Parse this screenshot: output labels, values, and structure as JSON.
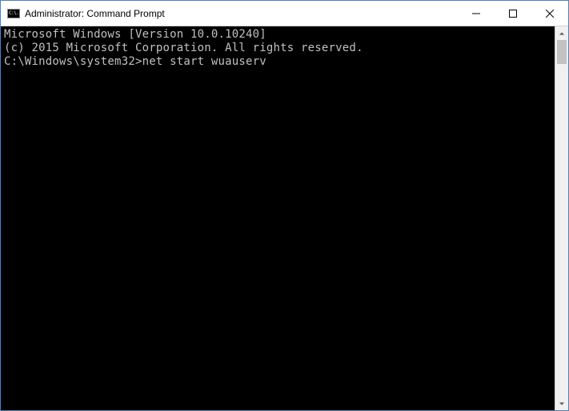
{
  "window": {
    "icon_label": "C:\\.",
    "title": "Administrator: Command Prompt"
  },
  "terminal": {
    "line1": "Microsoft Windows [Version 10.0.10240]",
    "line2": "(c) 2015 Microsoft Corporation. All rights reserved.",
    "blank": "",
    "prompt": "C:\\Windows\\system32>",
    "command": "net start wuauserv"
  }
}
